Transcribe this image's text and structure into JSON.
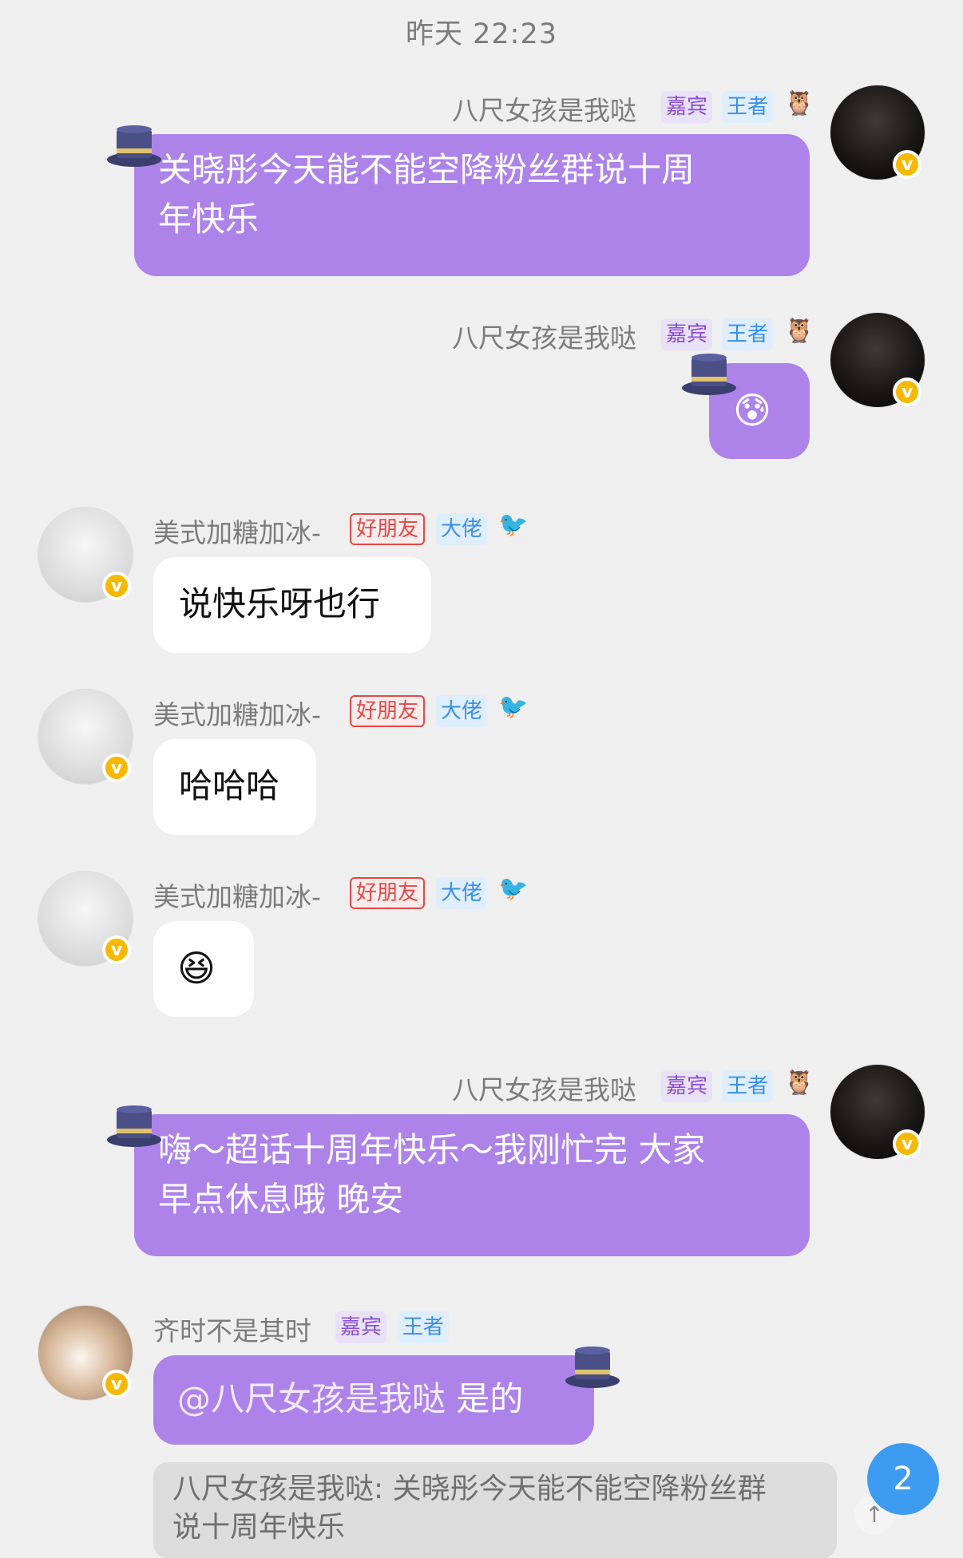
{
  "timestamp": "昨天 22:23",
  "messages": [
    {
      "sender": "八尺女孩是我哒",
      "tags": [
        "嘉宾",
        "王者"
      ],
      "deco_icon": "owl",
      "side": "right",
      "text": "关晓彤今天能不能空降粉丝群说十周\n年快乐"
    },
    {
      "sender": "八尺女孩是我哒",
      "tags": [
        "嘉宾",
        "王者"
      ],
      "deco_icon": "owl",
      "side": "right",
      "emoji": "😰"
    },
    {
      "sender": "美式加糖加冰-",
      "tags": [
        "好朋友",
        "大佬"
      ],
      "deco_icon": "bird",
      "side": "left",
      "text": "说快乐呀也行"
    },
    {
      "sender": "美式加糖加冰-",
      "tags": [
        "好朋友",
        "大佬"
      ],
      "deco_icon": "bird",
      "side": "left",
      "text": "哈哈哈"
    },
    {
      "sender": "美式加糖加冰-",
      "tags": [
        "好朋友",
        "大佬"
      ],
      "deco_icon": "bird",
      "side": "left",
      "emoji": "😆"
    },
    {
      "sender": "八尺女孩是我哒",
      "tags": [
        "嘉宾",
        "王者"
      ],
      "deco_icon": "owl",
      "side": "right",
      "text": "嗨～超话十周年快乐～我刚忙完 大家\n早点休息哦 晚安"
    },
    {
      "sender": "齐时不是其时",
      "tags": [
        "嘉宾",
        "王者"
      ],
      "side": "left",
      "mention": "@八尺女孩是我哒",
      "text": " 是的",
      "quote": "八尺女孩是我哒: 关晓彤今天能不能空降粉丝群\n说十周年快乐"
    }
  ],
  "unread_count": "2",
  "verified_mark": "v",
  "colors": {
    "bubble_purple": "#ad83ea",
    "bubble_white": "#ffffff",
    "unread_blue": "#3d9bf2",
    "badge_gold": "#f7b800"
  }
}
